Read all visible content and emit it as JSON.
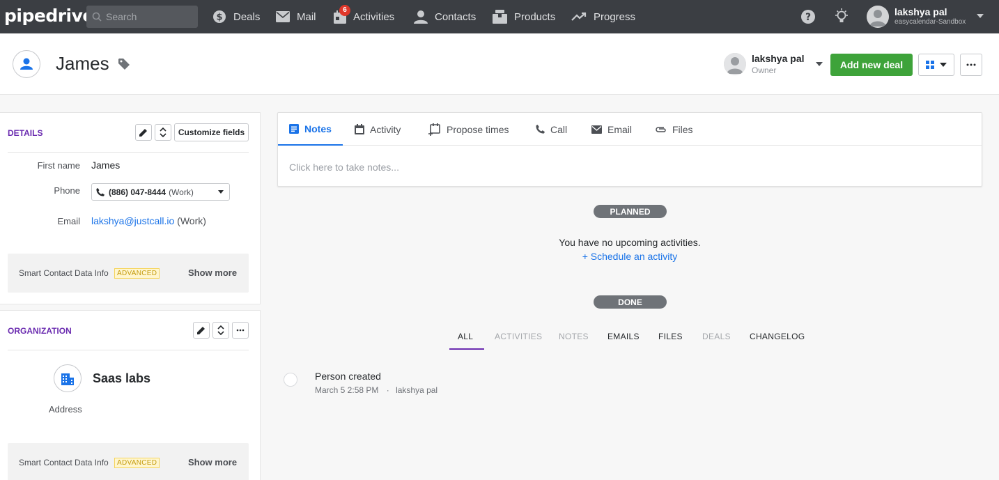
{
  "nav": {
    "logo": "pipedrive",
    "search_placeholder": "Search",
    "items": [
      {
        "label": "Deals",
        "icon": "dollar-icon"
      },
      {
        "label": "Mail",
        "icon": "mail-icon"
      },
      {
        "label": "Activities",
        "icon": "calendar-icon",
        "badge": "6"
      },
      {
        "label": "Contacts",
        "icon": "person-icon"
      },
      {
        "label": "Products",
        "icon": "box-icon"
      },
      {
        "label": "Progress",
        "icon": "trend-icon"
      }
    ],
    "user": {
      "name": "lakshya pal",
      "company": "easycalendar-Sandbox"
    }
  },
  "header": {
    "person_name": "James",
    "owner_name": "lakshya pal",
    "owner_label": "Owner",
    "add_deal_label": "Add new deal"
  },
  "details": {
    "title": "DETAILS",
    "customize_label": "Customize fields",
    "first_name_label": "First name",
    "first_name": "James",
    "phone_label": "Phone",
    "phone": "(886) 047-8444",
    "phone_type": "(Work)",
    "email_label": "Email",
    "email": "lakshya@justcall.io",
    "email_type": "(Work)",
    "smart_label": "Smart Contact Data Info",
    "advanced": "ADVANCED",
    "show_more": "Show more"
  },
  "organization": {
    "title": "ORGANIZATION",
    "name": "Saas labs",
    "address_label": "Address",
    "smart_label": "Smart Contact Data Info",
    "advanced": "ADVANCED",
    "show_more": "Show more"
  },
  "tabs": [
    {
      "label": "Notes",
      "active": true
    },
    {
      "label": "Activity"
    },
    {
      "label": "Propose times"
    },
    {
      "label": "Call"
    },
    {
      "label": "Email"
    },
    {
      "label": "Files"
    }
  ],
  "notes_placeholder": "Click here to take notes...",
  "planned": {
    "label": "PLANNED",
    "empty_text": "You have no upcoming activities.",
    "schedule_link": "+ Schedule an activity"
  },
  "done": {
    "label": "DONE",
    "filters": [
      "ALL",
      "ACTIVITIES",
      "NOTES",
      "EMAILS",
      "FILES",
      "DEALS",
      "CHANGELOG"
    ],
    "active_filter": "ALL"
  },
  "timeline": [
    {
      "title": "Person created",
      "date": "March 5 2:58 PM",
      "separator": "·",
      "user": "lakshya pal"
    }
  ],
  "colors": {
    "topbar": "#3b3e43",
    "accent_blue": "#1a73e8",
    "accent_purple": "#6b2cb0",
    "green": "#3ea33a",
    "badge_red": "#e0372a"
  }
}
